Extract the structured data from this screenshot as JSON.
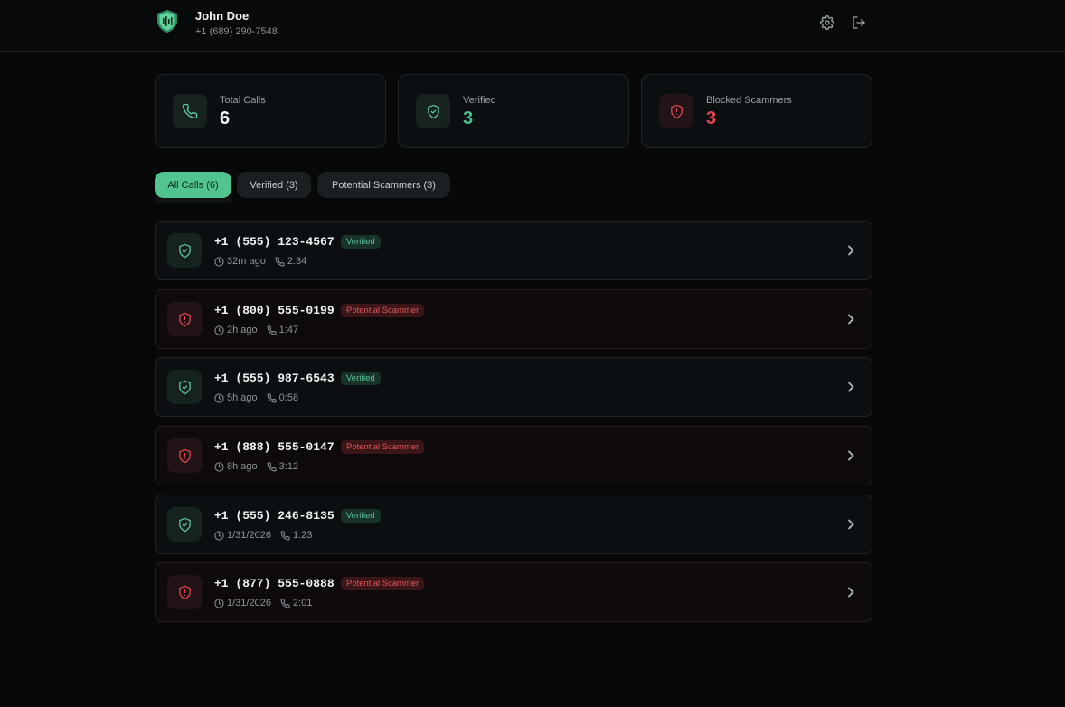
{
  "user": {
    "name": "John Doe",
    "phone": "+1 (689) 290-7548"
  },
  "header_icons": [
    "shield-logo-icon",
    "gear-icon",
    "logout-icon"
  ],
  "stats": [
    {
      "label": "Total Calls",
      "value": "6",
      "icon": "phone-icon",
      "color": "#f2f4f5"
    },
    {
      "label": "Verified",
      "value": "3",
      "icon": "shield-check-icon",
      "color": "#4fbf8a"
    },
    {
      "label": "Blocked Scammers",
      "value": "3",
      "icon": "shield-alert-icon",
      "color": "#e0474b"
    }
  ],
  "tabs": [
    {
      "label": "All Calls (6)",
      "active": true
    },
    {
      "label": "Verified (3)",
      "active": false
    },
    {
      "label": "Potential Scammers (3)",
      "active": false
    }
  ],
  "calls": [
    {
      "number": "+1 (555) 123-4567",
      "status": "Verified",
      "time": "32m ago",
      "duration": "2:34",
      "type": "verified"
    },
    {
      "number": "+1 (800) 555-0199",
      "status": "Potential Scammer",
      "time": "2h ago",
      "duration": "1:47",
      "type": "scam"
    },
    {
      "number": "+1 (555) 987-6543",
      "status": "Verified",
      "time": "5h ago",
      "duration": "0:58",
      "type": "verified"
    },
    {
      "number": "+1 (888) 555-0147",
      "status": "Potential Scammer",
      "time": "8h ago",
      "duration": "3:12",
      "type": "scam"
    },
    {
      "number": "+1 (555) 246-8135",
      "status": "Verified",
      "time": "1/31/2026",
      "duration": "1:23",
      "type": "verified"
    },
    {
      "number": "+1 (877) 555-0888",
      "status": "Potential Scammer",
      "time": "1/31/2026",
      "duration": "2:01",
      "type": "scam"
    }
  ],
  "colors": {
    "accent_green": "#52c48f",
    "danger_red": "#e0474b",
    "background": "#060809"
  }
}
